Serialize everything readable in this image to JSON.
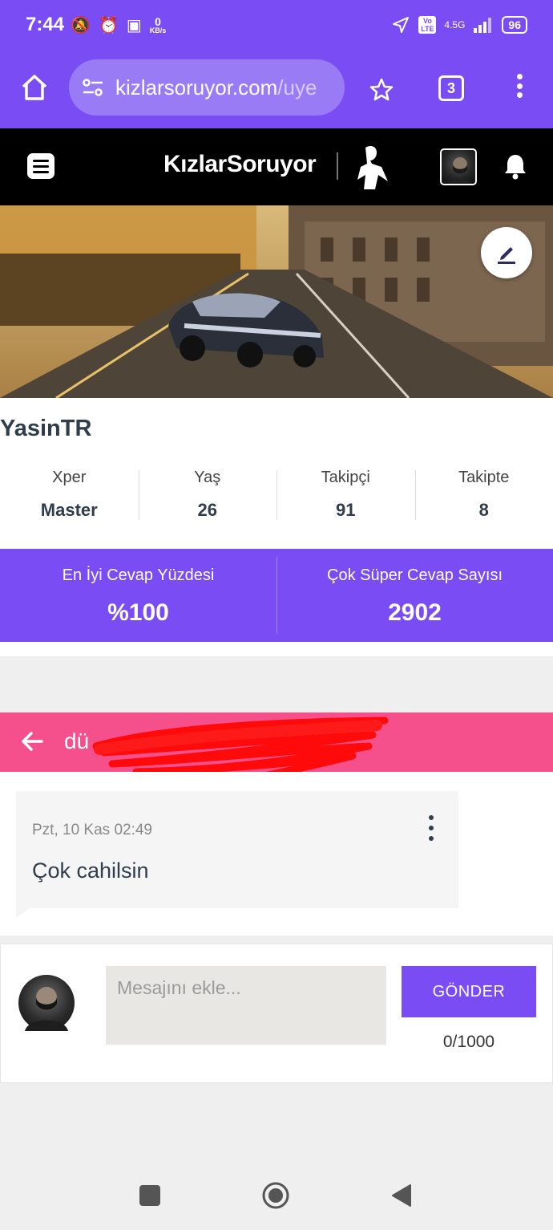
{
  "status_bar": {
    "time": "7:44",
    "data_speed": "0",
    "data_unit": "KB/s",
    "network": "4.5G",
    "volte": "Vo LTE",
    "battery": "96"
  },
  "browser": {
    "url_main": "kizlarsoruyor.com",
    "url_tail": "/uye",
    "tab_count": "3"
  },
  "site": {
    "logo": "KızlarSoruyor"
  },
  "profile": {
    "username": "YasinTR",
    "stats": [
      {
        "label": "Xper",
        "value": "Master"
      },
      {
        "label": "Yaş",
        "value": "26"
      },
      {
        "label": "Takipçi",
        "value": "91"
      },
      {
        "label": "Takipte",
        "value": "8"
      }
    ],
    "highlights": [
      {
        "label": "En İyi Cevap Yüzdesi",
        "value": "%100"
      },
      {
        "label": "Çok Süper Cevap Sayısı",
        "value": "2902"
      }
    ]
  },
  "chat": {
    "partner_name_visible": "dü",
    "messages": [
      {
        "time": "Pzt, 10 Kas 02:49",
        "text": "Çok cahilsin"
      }
    ]
  },
  "composer": {
    "placeholder": "Mesajını ekle...",
    "send_label": "GÖNDER",
    "counter": "0/1000"
  },
  "colors": {
    "brand_purple": "#7a4cf4",
    "chat_pink": "#f5508b"
  }
}
